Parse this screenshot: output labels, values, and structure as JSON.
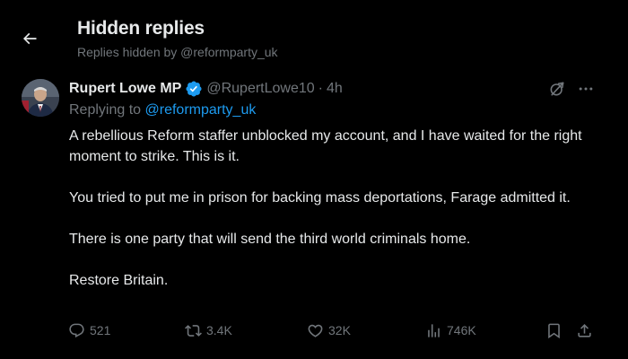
{
  "header": {
    "title": "Hidden replies",
    "subtitle": "Replies hidden by @reformparty_uk"
  },
  "post": {
    "display_name": "Rupert Lowe MP",
    "handle": "@RupertLowe10",
    "separator": "·",
    "time": "4h",
    "replying_prefix": "Replying to ",
    "replying_to": "@reformparty_uk",
    "paragraphs": [
      "A rebellious Reform staffer unblocked my account, and I have waited for the right moment to strike. This is it.",
      "You tried to put me in prison for backing mass deportations, Farage admitted it.",
      "There is one party that will send the third world criminals home.",
      "Restore Britain."
    ],
    "stats": {
      "replies": "521",
      "reposts": "3.4K",
      "likes": "32K",
      "views": "746K"
    }
  },
  "icons": {
    "back": "arrow-left-icon",
    "verified": "verified-badge-icon",
    "grok": "grok-icon",
    "more": "more-horizontal-icon",
    "reply": "reply-icon",
    "repost": "repost-icon",
    "like": "heart-icon",
    "views": "views-chart-icon",
    "bookmark": "bookmark-icon",
    "share": "share-icon"
  },
  "colors": {
    "background": "#000000",
    "text_primary": "#e7e9ea",
    "text_secondary": "#71767b",
    "link": "#1d9bf0",
    "verified": "#1d9bf0"
  }
}
